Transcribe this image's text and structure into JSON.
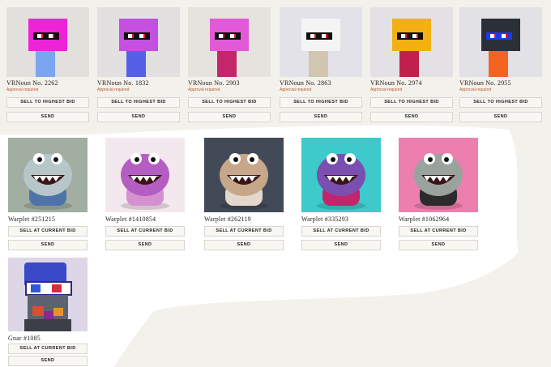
{
  "row1": [
    {
      "name": "VRNoun No. 2262",
      "status": "Approval required",
      "primary": "SELL TO HIGHEST BID",
      "secondary": "SEND",
      "head": "#ee22d6",
      "body": "#7aa6f0",
      "visor": "#111",
      "bg": "#e2e0dc"
    },
    {
      "name": "VRNoun No. 1832",
      "status": "Approval required",
      "primary": "SELL TO HIGHEST BID",
      "secondary": "SEND",
      "head": "#c44fe0",
      "body": "#5460e6",
      "visor": "#111",
      "bg": "#e3e0e2"
    },
    {
      "name": "VRNoun No. 2903",
      "status": "Approval required",
      "primary": "SELL TO HIGHEST BID",
      "secondary": "SEND",
      "head": "#e35ad8",
      "body": "#c4266b",
      "visor": "#111",
      "bg": "#e6e2de"
    },
    {
      "name": "VRNoun No. 2863",
      "status": "Approval required",
      "primary": "SELL TO HIGHEST BID",
      "secondary": "SEND",
      "head": "#f4f4f4",
      "body": "#d2c6b0",
      "visor": "#111",
      "bg": "#e2e2e8"
    },
    {
      "name": "VRNoun No. 2974",
      "status": "Approval required",
      "primary": "SELL TO HIGHEST BID",
      "secondary": "SEND",
      "head": "#f2b012",
      "body": "#c0214c",
      "visor": "#111",
      "bg": "#e3e1e6"
    },
    {
      "name": "VRNoun No. 2955",
      "status": "Approval required",
      "primary": "SELL TO HIGHEST BID",
      "secondary": "SEND",
      "head": "#2a2f38",
      "body": "#f46420",
      "visor": "#1c3ae8",
      "bg": "#e2e1e6"
    }
  ],
  "row2": [
    {
      "name": "Warplet #251215",
      "primary": "SELL AT CURRENT BID",
      "secondary": "SEND",
      "bg": "#a3aea2",
      "creature": "#b7c6c8",
      "accent": "#4f73a8"
    },
    {
      "name": "Warplet #1410854",
      "primary": "SELL AT CURRENT BID",
      "secondary": "SEND",
      "bg": "#f4e8ef",
      "creature": "#b35ec0",
      "accent": "#d591cf"
    },
    {
      "name": "Warplet #262119",
      "primary": "SELL AT CURRENT BID",
      "secondary": "SEND",
      "bg": "#434a57",
      "creature": "#c7a78a",
      "accent": "#e4d8cd"
    },
    {
      "name": "Warplet #335293",
      "primary": "SELL AT CURRENT BID",
      "secondary": "SEND",
      "bg": "#3ec9cb",
      "creature": "#7a4fb0",
      "accent": "#c3246b"
    },
    {
      "name": "Warplet #1062964",
      "primary": "SELL AT CURRENT BID",
      "secondary": "SEND",
      "bg": "#ec7fae",
      "creature": "#9aa29e",
      "accent": "#2b2b2e"
    }
  ],
  "row3": [
    {
      "name": "Gnar #1085",
      "primary": "SELL AT CURRENT BID",
      "secondary": "SEND",
      "bg": "#dcd6e6",
      "creature": "#5b6270",
      "accent": "#3a49c8"
    }
  ]
}
